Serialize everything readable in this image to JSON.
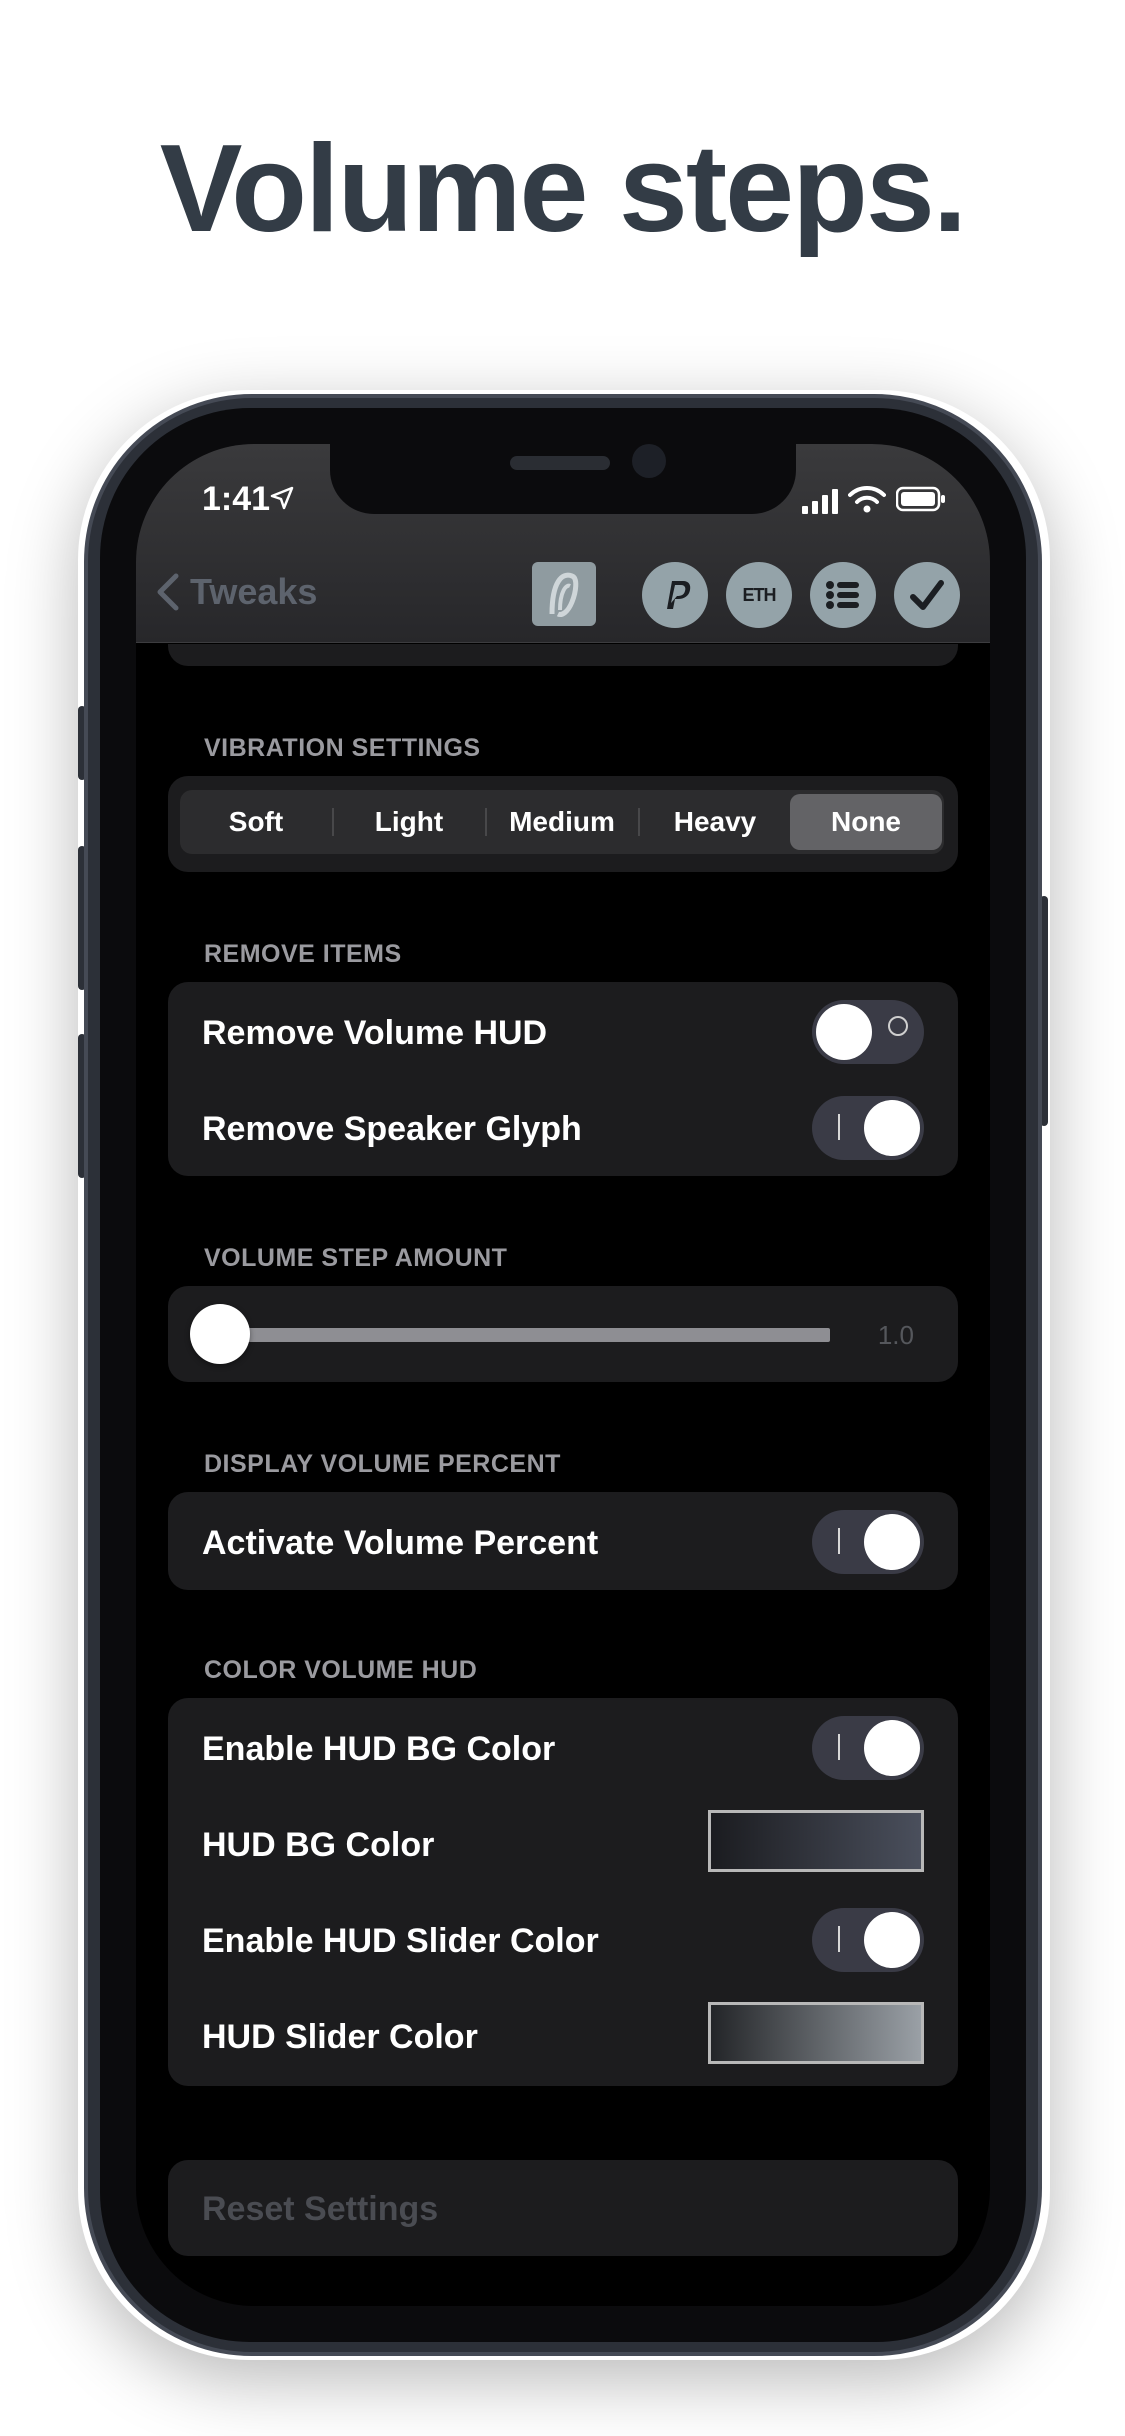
{
  "headline": "Volume steps.",
  "status": {
    "time": "1:41"
  },
  "nav": {
    "back_label": "Tweaks",
    "icons": [
      "paypal-icon",
      "ethereum-icon",
      "list-icon",
      "checkmark-icon"
    ]
  },
  "sections": {
    "vibration": {
      "header": "VIBRATION SETTINGS",
      "options": [
        "Soft",
        "Light",
        "Medium",
        "Heavy",
        "None"
      ],
      "selected": "None"
    },
    "remove_items": {
      "header": "REMOVE ITEMS",
      "rows": [
        {
          "label": "Remove Volume HUD",
          "enabled": false
        },
        {
          "label": "Remove Speaker Glyph",
          "enabled": true
        }
      ]
    },
    "volume_step": {
      "header": "VOLUME STEP AMOUNT",
      "value_label": "1.0",
      "fraction": 0.0
    },
    "display_percent": {
      "header": "DISPLAY VOLUME PERCENT",
      "rows": [
        {
          "label": "Activate Volume Percent",
          "enabled": true
        }
      ]
    },
    "color_hud": {
      "header": "COLOR VOLUME HUD",
      "rows": [
        {
          "label": "Enable HUD BG Color",
          "enabled": true
        },
        {
          "label": "HUD BG Color"
        },
        {
          "label": "Enable HUD Slider Color",
          "enabled": true
        },
        {
          "label": "HUD Slider Color"
        }
      ],
      "bg_gradient": [
        "#1b1c20",
        "#4a4f5c"
      ],
      "slider_gradient": [
        "#232528",
        "#9aa0a6"
      ]
    },
    "reset": {
      "label": "Reset Settings"
    }
  },
  "colors": {
    "accent": "#636366",
    "background": "#000000",
    "card": "#1c1c1e"
  }
}
